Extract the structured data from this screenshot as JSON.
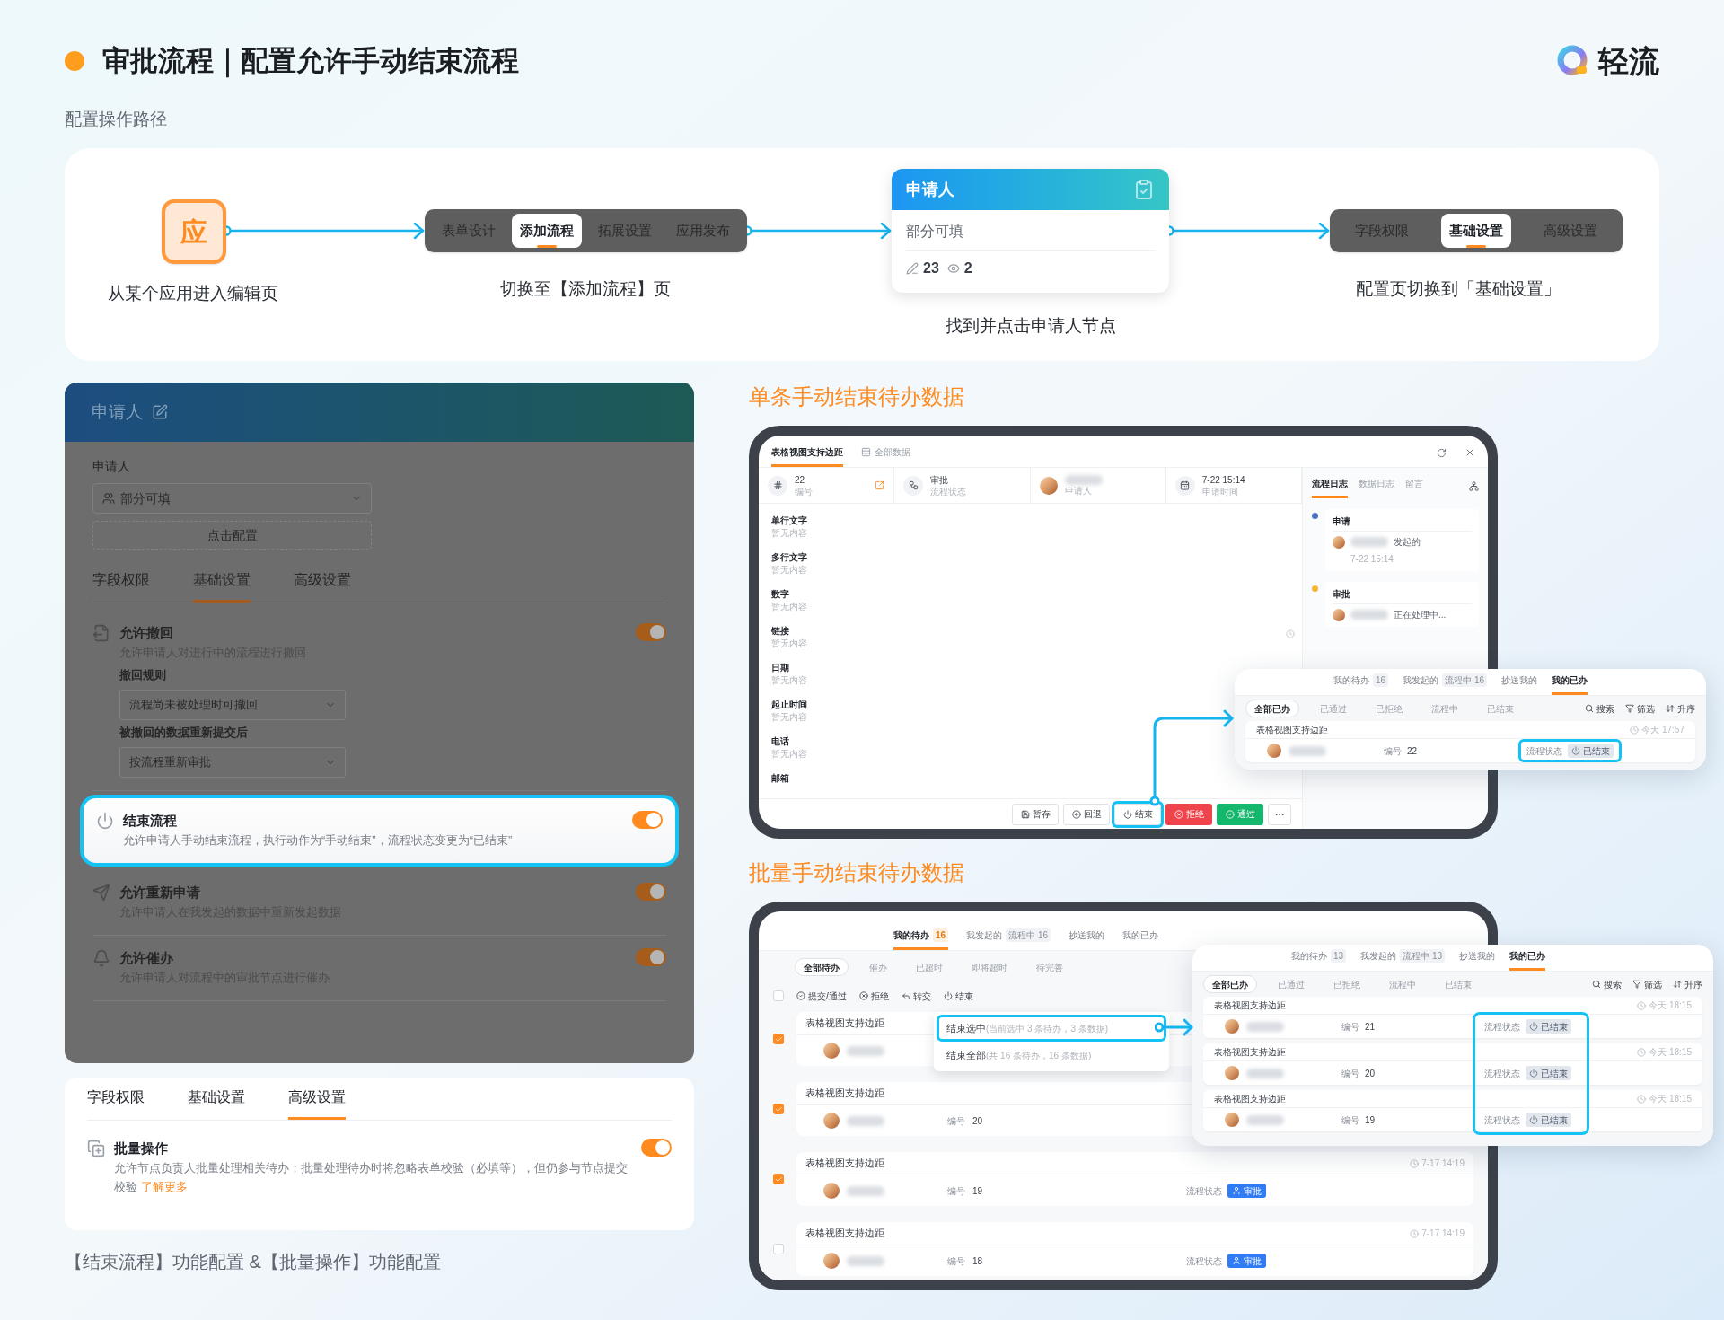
{
  "header": {
    "title": "审批流程｜配置允许手动结束流程",
    "brand": "轻流"
  },
  "path_label": "配置操作路径",
  "steps": [
    {
      "kind": "app_icon",
      "icon_text": "应",
      "caption": "从某个应用进入编辑页"
    },
    {
      "kind": "tabs",
      "tabs": [
        {
          "label": "表单设计",
          "selected": false
        },
        {
          "label": "添加流程",
          "selected": true
        },
        {
          "label": "拓展设置",
          "selected": false
        },
        {
          "label": "应用发布",
          "selected": false
        }
      ],
      "caption": "切换至【添加流程】页"
    },
    {
      "kind": "node",
      "title": "申请人",
      "subtitle": "部分可填",
      "edit_count": "23",
      "view_count": "2",
      "caption": "找到并点击申请人节点"
    },
    {
      "kind": "tabs",
      "tabs": [
        {
          "label": "字段权限",
          "selected": false
        },
        {
          "label": "基础设置",
          "selected": true
        },
        {
          "label": "高级设置",
          "selected": false
        }
      ],
      "caption": "配置页切换到「基础设置」"
    }
  ],
  "node_panel": {
    "title": "申请人",
    "field_label": "申请人",
    "permission": "部分可填",
    "config_button": "点击配置",
    "tabs": [
      {
        "label": "字段权限",
        "selected": false
      },
      {
        "label": "基础设置",
        "selected": true
      },
      {
        "label": "高级设置",
        "selected": false
      }
    ],
    "settings": [
      {
        "title": "允许撤回",
        "description": "允许申请人对进行中的流程进行撤回",
        "on": true,
        "highlighted": false,
        "options": [
          {
            "label": "撤回规则",
            "value": "流程尚未被处理时可撤回"
          },
          {
            "label": "被撤回的数据重新提交后",
            "value": "按流程重新审批"
          }
        ]
      },
      {
        "title": "结束流程",
        "description": "允许申请人手动结束流程，执行动作为“手动结束”，流程状态变更为“已结束”",
        "on": true,
        "highlighted": true
      },
      {
        "title": "允许重新申请",
        "description": "允许申请人在我发起的数据中重新发起数据",
        "on": true,
        "highlighted": false
      },
      {
        "title": "允许催办",
        "description": "允许申请人对流程中的审批节点进行催办",
        "on": true,
        "highlighted": false
      }
    ]
  },
  "advanced_panel": {
    "tabs": [
      {
        "label": "字段权限",
        "selected": false
      },
      {
        "label": "基础设置",
        "selected": false
      },
      {
        "label": "高级设置",
        "selected": true
      }
    ],
    "setting": {
      "title": "批量操作",
      "description": "允许节点负责人批量处理相关待办；批量处理待办时将忽略表单校验（必填等），但仍参与节点提交校验",
      "link": "了解更多",
      "on": true
    }
  },
  "caption": "【结束流程】功能配置 &【批量操作】功能配置",
  "single": {
    "title": "单条手动结束待办数据",
    "tabs": [
      {
        "label": "表格视图支持边距",
        "selected": true
      },
      {
        "label": "全部数据",
        "selected": false
      }
    ],
    "summary": [
      {
        "kind": "number",
        "value": "22",
        "label": "编号"
      },
      {
        "kind": "status",
        "value": "审批",
        "label": "流程状态"
      },
      {
        "kind": "person",
        "label": "申请人"
      },
      {
        "kind": "time",
        "value": "7-22 15:14",
        "label": "申请时间"
      }
    ],
    "fields": [
      {
        "label": "单行文字",
        "value": "暂无内容"
      },
      {
        "label": "多行文字",
        "value": "暂无内容"
      },
      {
        "label": "数字",
        "value": "暂无内容"
      },
      {
        "label": "链接",
        "value": "暂无内容"
      },
      {
        "label": "日期",
        "value": "暂无内容"
      },
      {
        "label": "起止时间",
        "value": "暂无内容"
      },
      {
        "label": "电话",
        "value": "暂无内容"
      },
      {
        "label": "邮箱"
      }
    ],
    "actions": [
      {
        "kind": "default",
        "label": "暂存",
        "highlighted": false
      },
      {
        "kind": "default",
        "label": "回退",
        "highlighted": false
      },
      {
        "kind": "default",
        "label": "结束",
        "highlighted": true
      },
      {
        "kind": "danger",
        "label": "拒绝",
        "highlighted": false
      },
      {
        "kind": "primary",
        "label": "通过",
        "highlighted": false
      }
    ],
    "side_tabs": [
      {
        "label": "流程日志",
        "selected": true
      },
      {
        "label": "数据日志",
        "selected": false
      },
      {
        "label": "留言",
        "selected": false
      }
    ],
    "log": [
      {
        "title": "申请",
        "text": "发起的",
        "time": "7-22 15:14",
        "color": "#4a72c9"
      },
      {
        "title": "审批",
        "text": "正在处理中...",
        "color": "#f7b52c"
      }
    ],
    "done_list": {
      "tabs": [
        {
          "label": "我的待办",
          "count": "16",
          "selected": false
        },
        {
          "label": "我发起的",
          "count": "流程中 16",
          "selected": false
        },
        {
          "label": "抄送我的",
          "selected": false
        },
        {
          "label": "我的已办",
          "selected": true
        }
      ],
      "filters": [
        {
          "label": "全部已办",
          "selected": true
        },
        {
          "label": "已通过",
          "selected": false
        },
        {
          "label": "已拒绝",
          "selected": false
        },
        {
          "label": "流程中",
          "selected": false
        },
        {
          "label": "已结束",
          "selected": false
        }
      ],
      "tools": [
        "搜索",
        "筛选",
        "升序"
      ],
      "rows": [
        {
          "title": "表格视图支持边距",
          "time": "今天 17:57",
          "number_label": "编号",
          "number": "22",
          "status_label": "流程状态",
          "status": "已结束",
          "highlighted": true
        }
      ]
    }
  },
  "batch": {
    "title": "批量手动结束待办数据",
    "tabs": [
      {
        "label": "我的待办",
        "count": "16",
        "selected": true
      },
      {
        "label": "我发起的",
        "count": "流程中 16",
        "selected": false
      },
      {
        "label": "抄送我的",
        "selected": false
      },
      {
        "label": "我的已办",
        "selected": false
      }
    ],
    "filters": [
      {
        "label": "全部待办",
        "selected": true
      },
      {
        "label": "催办",
        "selected": false
      },
      {
        "label": "已超时",
        "selected": false
      },
      {
        "label": "即将超时",
        "selected": false
      },
      {
        "label": "待完善",
        "selected": false
      }
    ],
    "select_all": false,
    "actions": [
      "提交/通过",
      "拒绝",
      "转交",
      "结束"
    ],
    "menu": [
      {
        "label": "结束选中",
        "hint": "(当前选中 3 条待办，3 条数据)",
        "highlighted": true
      },
      {
        "label": "结束全部",
        "hint": "(共 16 条待办，16 条数据)",
        "highlighted": false
      }
    ],
    "rows": [
      {
        "title": "表格视图支持边距",
        "checked": true
      },
      {
        "title": "表格视图支持边距",
        "checked": true,
        "number_label": "编号",
        "number": "20"
      },
      {
        "title": "表格视图支持边距",
        "checked": true,
        "number_label": "编号",
        "number": "19",
        "time": "7-17 14:19",
        "status_label": "流程状态",
        "status": "审批"
      },
      {
        "title": "表格视图支持边距",
        "checked": false,
        "number_label": "编号",
        "number": "18",
        "time": "7-17 14:19",
        "status_label": "流程状态",
        "status": "审批"
      }
    ],
    "done_list": {
      "tabs": [
        {
          "label": "我的待办",
          "count": "13",
          "selected": false
        },
        {
          "label": "我发起的",
          "count": "流程中 13",
          "selected": false
        },
        {
          "label": "抄送我的",
          "selected": false
        },
        {
          "label": "我的已办",
          "selected": true
        }
      ],
      "filters": [
        {
          "label": "全部已办",
          "selected": true
        },
        {
          "label": "已通过",
          "selected": false
        },
        {
          "label": "已拒绝",
          "selected": false
        },
        {
          "label": "流程中",
          "selected": false
        },
        {
          "label": "已结束",
          "selected": false
        }
      ],
      "tools": [
        "搜索",
        "筛选",
        "升序"
      ],
      "status_highlighted": true,
      "rows": [
        {
          "title": "表格视图支持边距",
          "time": "今天 18:15",
          "number_label": "编号",
          "number": "21",
          "status_label": "流程状态",
          "status": "已结束"
        },
        {
          "title": "表格视图支持边距",
          "time": "今天 18:15",
          "number_label": "编号",
          "number": "20",
          "status_label": "流程状态",
          "status": "已结束"
        },
        {
          "title": "表格视图支持边距",
          "time": "今天 18:15",
          "number_label": "编号",
          "number": "19",
          "status_label": "流程状态",
          "status": "已结束"
        }
      ]
    }
  }
}
